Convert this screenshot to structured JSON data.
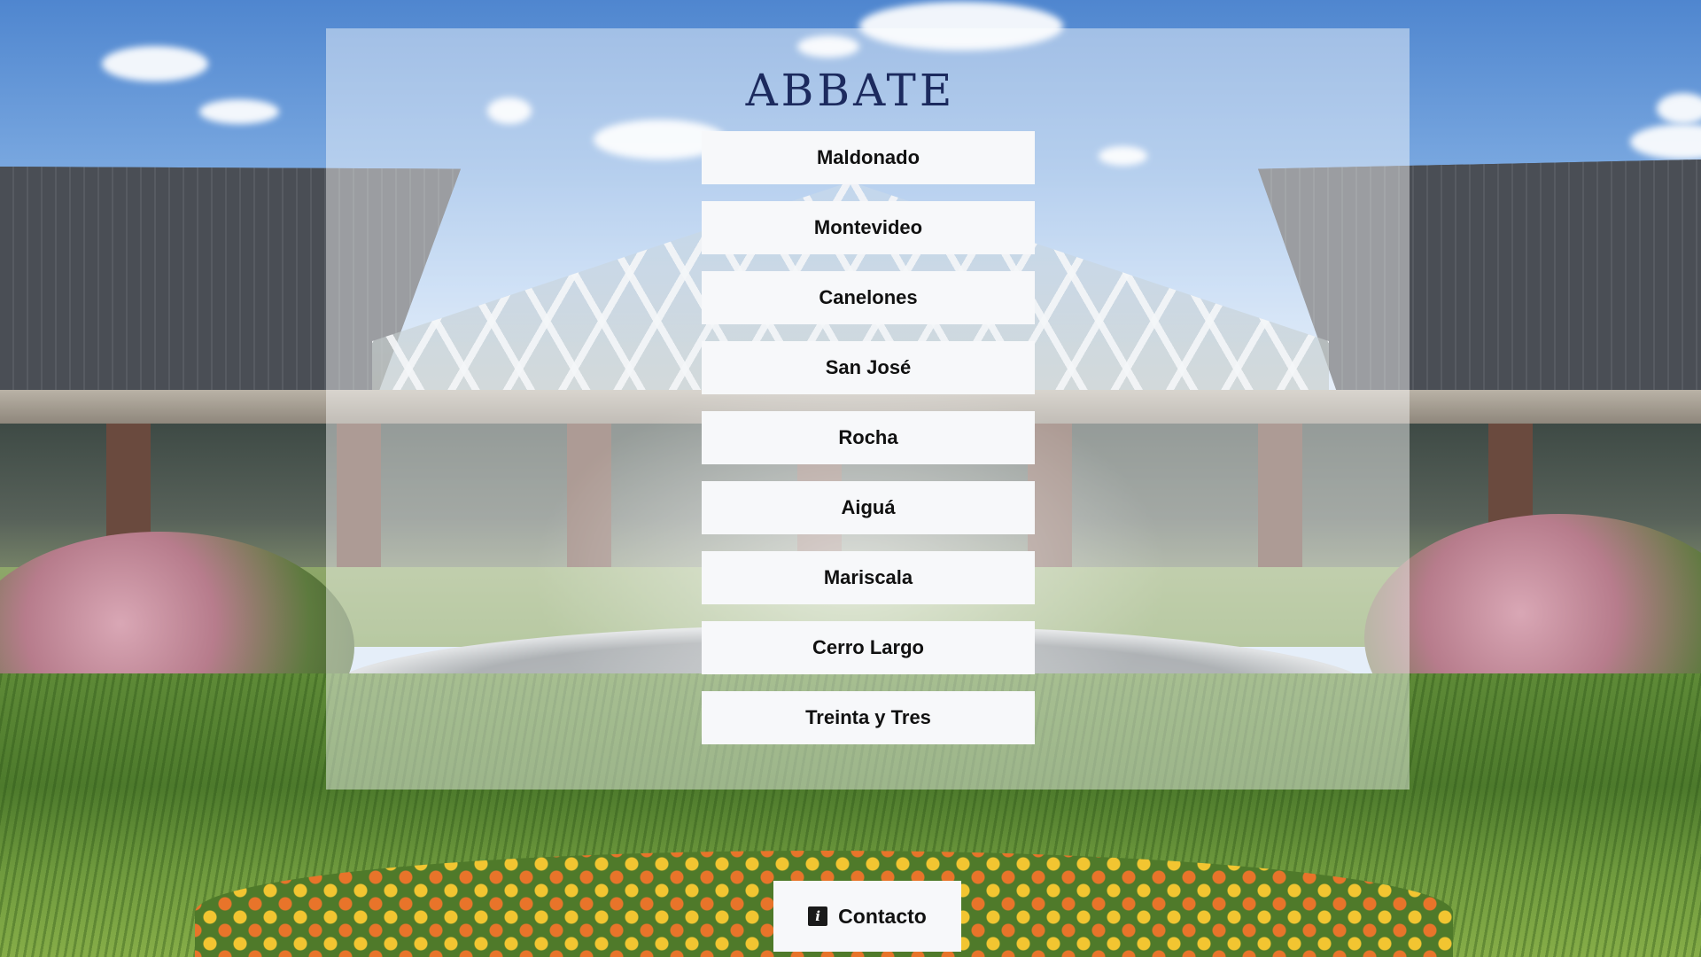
{
  "brand": {
    "logo_text": "ABBATE",
    "logo_color": "#1c2a5e"
  },
  "menu": {
    "items": [
      {
        "label": "Maldonado"
      },
      {
        "label": "Montevideo"
      },
      {
        "label": "Canelones"
      },
      {
        "label": "San José"
      },
      {
        "label": "Rocha"
      },
      {
        "label": "Aiguá"
      },
      {
        "label": "Mariscala"
      },
      {
        "label": "Cerro Largo"
      },
      {
        "label": "Treinta y Tres"
      }
    ]
  },
  "contact": {
    "label": "Contacto",
    "icon": "info-icon",
    "icon_glyph": "i"
  },
  "background": {
    "image": "garden-fountain-pavilion-photo"
  }
}
